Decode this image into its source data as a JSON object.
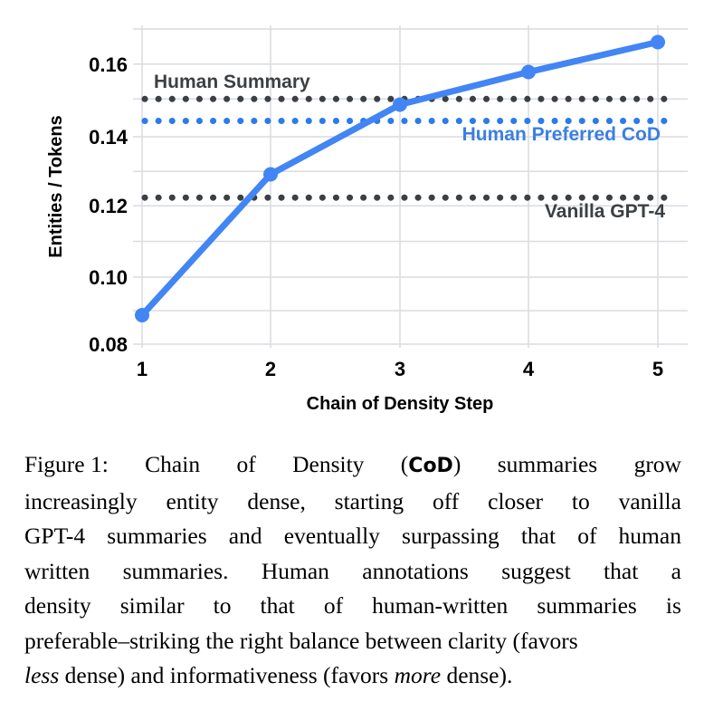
{
  "figure": {
    "axes": {
      "y_label": "Entities / Tokens",
      "x_label": "Chain of Density Step",
      "y_ticks": [
        "0.08",
        "0.10",
        "0.12",
        "0.14",
        "0.16"
      ],
      "x_ticks": [
        "1",
        "2",
        "3",
        "4",
        "5"
      ]
    },
    "annotations": {
      "human_summary": "Human Summary",
      "human_preferred_cod": "Human Preferred CoD",
      "vanilla_gpt4": "Vanilla GPT-4"
    },
    "colors": {
      "cod_line": "#4285F4",
      "reference_dark": "#3c4043",
      "reference_blue": "#4285F4",
      "grid": "#dadce0",
      "text": "#000000"
    }
  },
  "chart_data": {
    "type": "line",
    "title": "",
    "xlabel": "Chain of Density Step",
    "ylabel": "Entities / Tokens",
    "x": [
      1,
      2,
      3,
      4,
      5
    ],
    "xlim": [
      0.85,
      5.15
    ],
    "ylim": [
      0.0795,
      0.1695
    ],
    "grid": true,
    "legend": "none (inline annotations)",
    "series": [
      {
        "name": "Chain of Density (CoD)",
        "type": "line",
        "marker": "circle",
        "color": "#4285F4",
        "values": [
          0.0885,
          0.129,
          0.149,
          0.158,
          0.1665
        ]
      }
    ],
    "reference_lines": [
      {
        "name": "Human Summary",
        "value": 0.1505,
        "style": "dotted",
        "color": "#3c4043",
        "label_position": "above-left"
      },
      {
        "name": "Human Preferred CoD",
        "value": 0.1445,
        "style": "dotted",
        "color": "#4285F4",
        "label_position": "below-right"
      },
      {
        "name": "Vanilla GPT-4",
        "value": 0.1225,
        "style": "dotted",
        "color": "#3c4043",
        "label_position": "below-right"
      }
    ],
    "y_ticks": [
      0.08,
      0.1,
      0.12,
      0.14,
      0.16
    ],
    "y_minor_ticks": [
      0.09,
      0.11,
      0.13,
      0.15
    ],
    "x_ticks": [
      1,
      2,
      3,
      4,
      5
    ]
  },
  "caption": {
    "lines": [
      {
        "segments": [
          {
            "text": "Figure 1:",
            "style": "normal"
          },
          {
            "text": "Chain of Density (",
            "style": "normal"
          },
          {
            "text": "CoD",
            "style": "mono-bold"
          },
          {
            "text": ") summaries grow",
            "style": "normal"
          }
        ]
      },
      {
        "text": "increasingly entity dense, starting off closer to vanilla"
      },
      {
        "text": "GPT-4 summaries and eventually surpassing that of human"
      },
      {
        "text": "written summaries.  Human annotations suggest that a"
      },
      {
        "text": "density similar to that of human-written summaries is"
      },
      {
        "text": "preferable–striking the right balance between clarity (favors"
      },
      {
        "segments": [
          {
            "text": "less",
            "style": "italic"
          },
          {
            "text": " dense) and informativeness (favors ",
            "style": "normal"
          },
          {
            "text": "more",
            "style": "italic"
          },
          {
            "text": " dense).",
            "style": "normal"
          }
        ]
      }
    ],
    "full_text": "Figure 1: Chain of Density (CoD) summaries grow increasingly entity dense, starting off closer to vanilla GPT-4 summaries and eventually surpassing that of human written summaries. Human annotations suggest that a density similar to that of human-written summaries is preferable–striking the right balance between clarity (favors less dense) and informativeness (favors more dense)."
  }
}
